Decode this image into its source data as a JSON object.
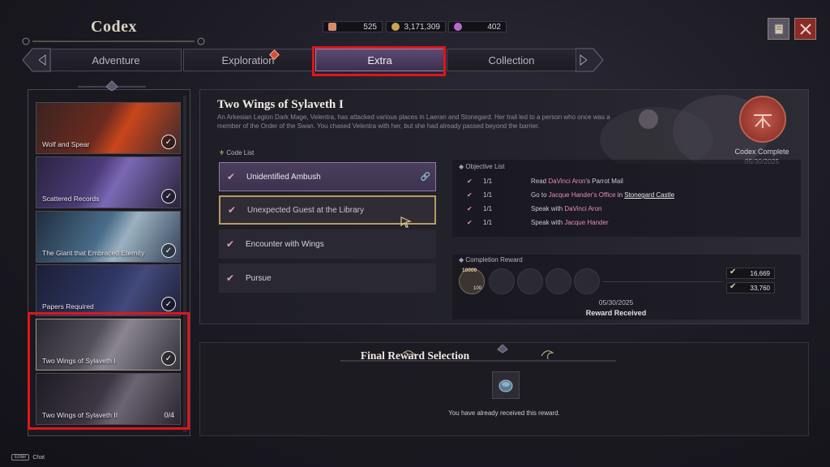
{
  "header": {
    "title": "Codex"
  },
  "currencies": [
    {
      "icon": "scroll-icon",
      "value": "525",
      "color": "#d68b6e"
    },
    {
      "icon": "gold-coin-icon",
      "value": "3,171,309",
      "color": "#c8a54f"
    },
    {
      "icon": "gem-icon",
      "value": "402",
      "color": "#b86ac8"
    }
  ],
  "tabs": [
    {
      "label": "Adventure"
    },
    {
      "label": "Exploration"
    },
    {
      "label": "Extra"
    },
    {
      "label": "Collection"
    }
  ],
  "sidebar": {
    "items": [
      {
        "label": "Wolf and Spear",
        "status": "complete"
      },
      {
        "label": "Scattered Records",
        "status": "complete"
      },
      {
        "label": "The Giant that Embraced Eternity",
        "status": "complete"
      },
      {
        "label": "Papers Required",
        "status": "complete"
      },
      {
        "label": "Two Wings of Sylaveth I",
        "status": "complete"
      },
      {
        "label": "Two Wings of Sylaveth II",
        "count": "0/4"
      }
    ]
  },
  "detail": {
    "title": "Two Wings of Sylaveth I",
    "description": "An Arkesian Legion Dark Mage, Velentra, has attacked various places in Laeran and Stonegard. Her trail led to a person who once was a member of the Order of the Swan. You chased Velentra with her, but she had already passed beyond the barrier.",
    "code_list_label": "Code List",
    "code_items": [
      {
        "label": "Unidentified Ambush"
      },
      {
        "label": "Unexpected Guest at the Library"
      },
      {
        "label": "Encounter with Wings"
      },
      {
        "label": "Pursue"
      }
    ],
    "codex_complete_label": "Codex Complete",
    "codex_complete_date": "05/30/2025",
    "objective_list_label": "Objective List",
    "objectives": [
      {
        "progress": "1/1",
        "prefix": "Read ",
        "highlight": "DaVinci Aron",
        "suffix": "'s Parrot Mail",
        "extra": ""
      },
      {
        "progress": "1/1",
        "prefix": "Go to ",
        "highlight": "Jacque Hander's Office",
        "suffix": " in ",
        "extra": "Stonegard Castle"
      },
      {
        "progress": "1/1",
        "prefix": "Speak with ",
        "highlight": "DaVinci Aron",
        "suffix": "",
        "extra": ""
      },
      {
        "progress": "1/1",
        "prefix": "Speak with ",
        "highlight": "Jacque Hander",
        "suffix": "",
        "extra": ""
      }
    ],
    "completion_reward_label": "Completion Reward",
    "reward_item_top": "10000",
    "reward_item_bottom": "100",
    "reward_values": [
      "16,669",
      "33,760"
    ],
    "reward_date": "05/30/2025",
    "reward_received_label": "Reward Received"
  },
  "final_reward": {
    "title": "Final Reward Selection",
    "message": "You have already received this reward."
  },
  "footer": {
    "key": "Enter",
    "label": "Chat"
  }
}
